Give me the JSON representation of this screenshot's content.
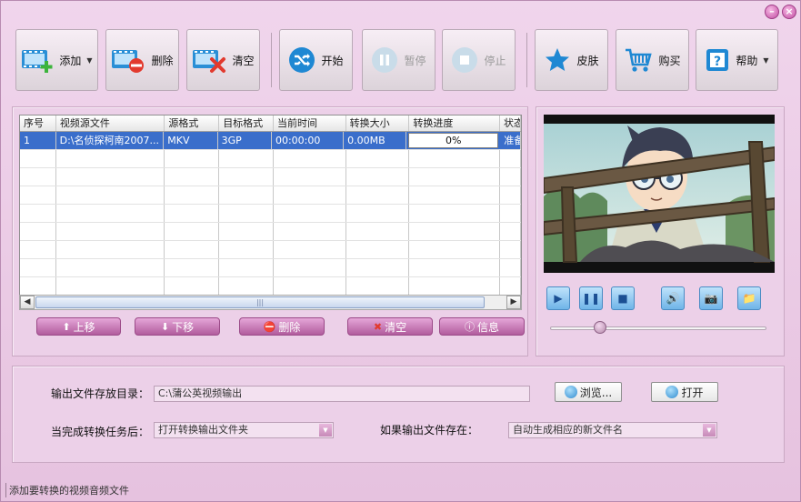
{
  "toolbar": {
    "add": "添加",
    "delete": "删除",
    "clear": "清空",
    "start": "开始",
    "pause": "暂停",
    "stop": "停止",
    "skin": "皮肤",
    "buy": "购买",
    "help": "帮助"
  },
  "table": {
    "columns": [
      "序号",
      "视频源文件",
      "源格式",
      "目标格式",
      "当前时间",
      "转换大小",
      "转换进度",
      "状态"
    ],
    "rows": [
      {
        "index": "1",
        "source": "D:\\名侦探柯南2007...",
        "src_format": "MKV",
        "dst_format": "3GP",
        "time": "00:00:00",
        "size": "0.00MB",
        "progress": "0%",
        "status": "准备"
      }
    ]
  },
  "list_actions": {
    "up": "上移",
    "down": "下移",
    "delete": "删除",
    "clear": "清空",
    "info": "信息"
  },
  "output": {
    "dir_label": "输出文件存放目录：",
    "dir_value": "C:\\蒲公英视频输出",
    "browse": "浏览...",
    "open": "打开",
    "after_label": "当完成转换任务后：",
    "after_value": "打开转换输出文件夹",
    "exists_label": "如果输出文件存在：",
    "exists_value": "自动生成相应的新文件名"
  },
  "player": {
    "position": 0.23
  },
  "status_text": "添加要转换的视频音频文件",
  "window_controls": {
    "minimize": "–",
    "close": "×"
  },
  "colors": {
    "accent": "#b15c9d",
    "selection": "#3a6ecb",
    "window_bg": "#e9c6e2"
  }
}
